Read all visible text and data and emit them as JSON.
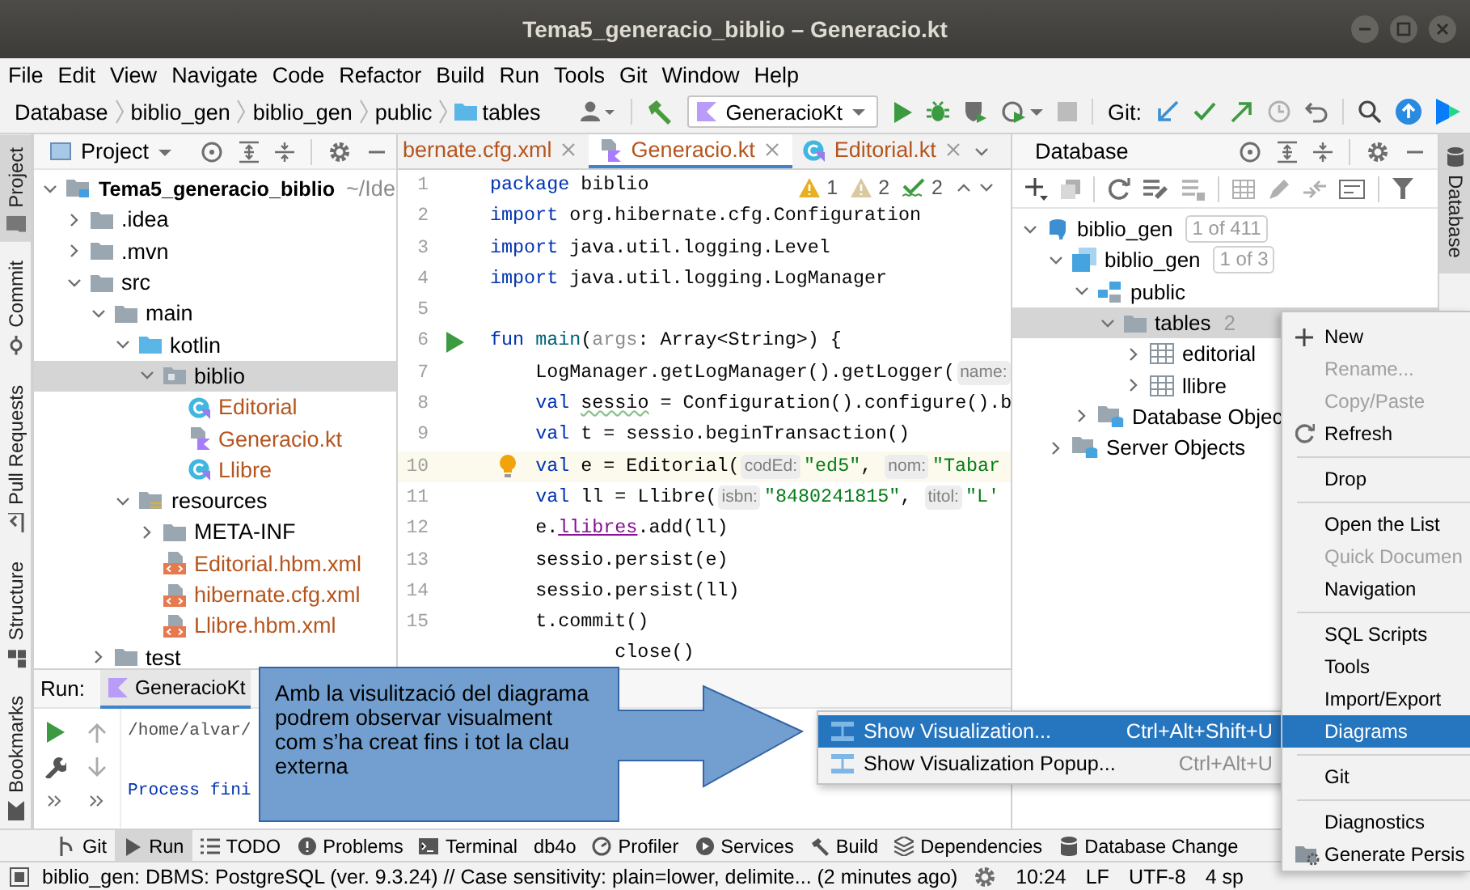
{
  "window": {
    "title": "Tema5_generacio_biblio – Generacio.kt"
  },
  "menu_bar": [
    "File",
    "Edit",
    "View",
    "Navigate",
    "Code",
    "Refactor",
    "Build",
    "Run",
    "Tools",
    "Git",
    "Window",
    "Help"
  ],
  "breadcrumb": [
    {
      "label": "Database"
    },
    {
      "label": "biblio_gen"
    },
    {
      "label": "biblio_gen"
    },
    {
      "label": "public"
    },
    {
      "label": "tables",
      "kind": "folder"
    }
  ],
  "toolbar": {
    "run_config": "GeneracioKt",
    "git_label": "Git:"
  },
  "left_tool_tabs": [
    {
      "label": "Project",
      "kind": "project",
      "selected": true
    },
    {
      "label": "Commit",
      "kind": "commit",
      "selected": false
    },
    {
      "label": "Pull Requests",
      "kind": "pull-requests",
      "selected": false
    },
    {
      "label": "Structure",
      "kind": "structure",
      "selected": false
    },
    {
      "label": "Bookmarks",
      "kind": "bookmarks",
      "selected": false
    }
  ],
  "project_panel": {
    "title": "Project",
    "tree": [
      {
        "label": "Tema5_generacio_biblio",
        "suffix": "~/Ide",
        "kind": "module",
        "expanded": true,
        "selected": false,
        "children": [
          {
            "label": ".idea",
            "kind": "folder",
            "expanded": false,
            "selected": false
          },
          {
            "label": ".mvn",
            "kind": "folder",
            "expanded": false,
            "selected": false
          },
          {
            "label": "src",
            "kind": "folder",
            "expanded": true,
            "selected": false,
            "children": [
              {
                "label": "main",
                "kind": "folder",
                "expanded": true,
                "selected": false,
                "children": [
                  {
                    "label": "kotlin",
                    "kind": "source-folder",
                    "expanded": true,
                    "selected": false,
                    "children": [
                      {
                        "label": "biblio",
                        "kind": "package",
                        "expanded": true,
                        "selected": true,
                        "children": [
                          {
                            "label": "Editorial",
                            "kind": "class",
                            "selected": false
                          },
                          {
                            "label": "Generacio.kt",
                            "kind": "kotlin-file",
                            "selected": false
                          },
                          {
                            "label": "Llibre",
                            "kind": "class",
                            "selected": false
                          }
                        ]
                      }
                    ]
                  },
                  {
                    "label": "resources",
                    "kind": "resources-folder",
                    "expanded": true,
                    "selected": false,
                    "children": [
                      {
                        "label": "META-INF",
                        "kind": "folder",
                        "expanded": false,
                        "selected": false
                      },
                      {
                        "label": "Editorial.hbm.xml",
                        "kind": "xml-file",
                        "selected": false
                      },
                      {
                        "label": "hibernate.cfg.xml",
                        "kind": "xml-file",
                        "selected": false
                      },
                      {
                        "label": "Llibre.hbm.xml",
                        "kind": "xml-file",
                        "selected": false
                      }
                    ]
                  }
                ]
              },
              {
                "label": "test",
                "kind": "folder",
                "expanded": false,
                "selected": false
              }
            ]
          }
        ]
      }
    ]
  },
  "editor": {
    "tabs": [
      {
        "label": "bernate.cfg.xml",
        "selected": false
      },
      {
        "label": "Generacio.kt",
        "kind": "kotlin-file",
        "selected": true
      },
      {
        "label": "Editorial.kt",
        "kind": "class",
        "selected": false
      }
    ],
    "inspections": [
      {
        "kind": "warning",
        "count": "1"
      },
      {
        "kind": "weak-warning",
        "count": "2"
      },
      {
        "kind": "typo",
        "count": "2"
      }
    ],
    "lines": [
      {
        "number": "1",
        "kind": "code",
        "current": false,
        "segments": [
          {
            "kind": "keyword",
            "text": "package"
          },
          {
            "kind": "plain",
            "text": " biblio"
          }
        ]
      },
      {
        "number": "2",
        "kind": "code",
        "current": false,
        "segments": [
          {
            "kind": "keyword",
            "text": "import"
          },
          {
            "kind": "plain",
            "text": " org.hibernate.cfg.Configuration"
          }
        ]
      },
      {
        "number": "3",
        "kind": "code",
        "current": false,
        "segments": [
          {
            "kind": "keyword",
            "text": "import"
          },
          {
            "kind": "plain",
            "text": " java.util.logging.Level"
          }
        ]
      },
      {
        "number": "4",
        "kind": "code",
        "current": false,
        "segments": [
          {
            "kind": "keyword",
            "text": "import"
          },
          {
            "kind": "plain",
            "text": " java.util.logging.LogManager"
          }
        ]
      },
      {
        "number": "5",
        "kind": "code",
        "current": false
      },
      {
        "number": "6",
        "kind": "run",
        "current": false,
        "segments": [
          {
            "kind": "keyword",
            "text": "fun "
          },
          {
            "kind": "function",
            "text": "main"
          },
          {
            "kind": "plain",
            "text": "("
          },
          {
            "kind": "unused",
            "text": "args"
          },
          {
            "kind": "plain",
            "text": ": Array<String>) {"
          }
        ]
      },
      {
        "number": "7",
        "kind": "code",
        "current": false,
        "segments": [
          {
            "kind": "plain",
            "text": "    LogManager.getLogManager().getLogger("
          },
          {
            "kind": "hint",
            "text": "name:"
          }
        ]
      },
      {
        "number": "8",
        "kind": "code",
        "current": false,
        "segments": [
          {
            "kind": "keyword",
            "text": "    val "
          },
          {
            "kind": "typo",
            "text": "sessio"
          },
          {
            "kind": "plain",
            "text": " = Configuration().configure().b"
          }
        ]
      },
      {
        "number": "9",
        "kind": "code",
        "current": false,
        "segments": [
          {
            "kind": "keyword",
            "text": "    val"
          },
          {
            "kind": "plain",
            "text": " t = sessio.beginTransaction()"
          }
        ]
      },
      {
        "number": "10",
        "kind": "bulb",
        "current": true,
        "segments": [
          {
            "kind": "keyword",
            "text": "    val"
          },
          {
            "kind": "plain",
            "text": " e = Editorial("
          },
          {
            "kind": "hint",
            "text": "codEd:"
          },
          {
            "kind": "string",
            "text": "\"ed5\""
          },
          {
            "kind": "plain",
            "text": ", "
          },
          {
            "kind": "hint",
            "text": "nom:"
          },
          {
            "kind": "string",
            "text": "\"Tabar"
          }
        ]
      },
      {
        "number": "11",
        "kind": "code",
        "current": false,
        "segments": [
          {
            "kind": "keyword",
            "text": "    val"
          },
          {
            "kind": "plain",
            "text": " ll = Llibre("
          },
          {
            "kind": "hint",
            "text": "isbn:"
          },
          {
            "kind": "string",
            "text": "\"8480241815\""
          },
          {
            "kind": "plain",
            "text": ", "
          },
          {
            "kind": "hint",
            "text": "titol:"
          },
          {
            "kind": "string",
            "text": "\"L'"
          }
        ]
      },
      {
        "number": "12",
        "kind": "code",
        "current": false,
        "segments": [
          {
            "kind": "plain",
            "text": "    e."
          },
          {
            "kind": "property",
            "text": "llibres"
          },
          {
            "kind": "plain",
            "text": ".add(ll)"
          }
        ]
      },
      {
        "number": "13",
        "kind": "code",
        "current": false,
        "segments": [
          {
            "kind": "plain",
            "text": "    sessio.persist(e)"
          }
        ]
      },
      {
        "number": "14",
        "kind": "code",
        "current": false,
        "segments": [
          {
            "kind": "plain",
            "text": "    sessio.persist(ll)"
          }
        ]
      },
      {
        "number": "15",
        "kind": "code",
        "current": false,
        "segments": [
          {
            "kind": "plain",
            "text": "    t.commit()"
          }
        ]
      },
      {
        "kind": "code",
        "current": false,
        "segments": [
          {
            "kind": "plain",
            "text": "           close()"
          }
        ]
      }
    ]
  },
  "database_panel": {
    "title": "Database",
    "tree": [
      {
        "label": "biblio_gen",
        "badge": "1 of 411",
        "kind": "datasource",
        "expanded": true,
        "selected": false,
        "children": [
          {
            "label": "biblio_gen",
            "badge": "1 of 3",
            "kind": "database",
            "expanded": true,
            "selected": false,
            "children": [
              {
                "label": "public",
                "kind": "schema",
                "expanded": true,
                "selected": false,
                "children": [
                  {
                    "label": "tables",
                    "count": "2",
                    "kind": "folder",
                    "expanded": true,
                    "selected": true,
                    "children": [
                      {
                        "label": "editorial",
                        "kind": "table",
                        "expanded": false,
                        "selected": false
                      },
                      {
                        "label": "llibre",
                        "kind": "table",
                        "expanded": false,
                        "selected": false
                      }
                    ]
                  }
                ]
              },
              {
                "label": "Database Objec",
                "kind": "objects-folder",
                "expanded": false,
                "selected": false
              }
            ]
          },
          {
            "label": "Server Objects",
            "kind": "objects-folder",
            "expanded": false,
            "selected": false
          }
        ]
      }
    ]
  },
  "right_tool_tabs": [
    {
      "label": "Database",
      "selected": true
    }
  ],
  "run_panel": {
    "label": "Run:",
    "tab": "GeneracioKt",
    "output": [
      {
        "kind": "command",
        "text": "/home/alvar/"
      },
      {
        "kind": "system",
        "text": "Process fini"
      }
    ]
  },
  "tool_window_bar": [
    {
      "label": "Git",
      "kind": "git",
      "selected": false
    },
    {
      "label": "Run",
      "kind": "run",
      "selected": true
    },
    {
      "label": "TODO",
      "kind": "todo",
      "selected": false
    },
    {
      "label": "Problems",
      "kind": "problems",
      "selected": false
    },
    {
      "label": "Terminal",
      "kind": "terminal",
      "selected": false
    },
    {
      "label": "db4o",
      "kind": "plugin",
      "selected": false
    },
    {
      "label": "Profiler",
      "kind": "profiler",
      "selected": false
    },
    {
      "label": "Services",
      "kind": "services",
      "selected": false
    },
    {
      "label": "Build",
      "kind": "build",
      "selected": false
    },
    {
      "label": "Dependencies",
      "kind": "dependencies",
      "selected": false
    },
    {
      "label": "Database Change",
      "kind": "database",
      "selected": false
    }
  ],
  "status_bar": {
    "message": "biblio_gen: DBMS: PostgreSQL (ver. 9.3.24) // Case sensitivity: plain=lower, delimite... (2 minutes ago)",
    "items": [
      "10:24",
      "LF",
      "UTF-8",
      "4 sp"
    ]
  },
  "context_menu": {
    "groups": [
      [
        {
          "label": "New",
          "kind": "new",
          "disabled": false,
          "selected": false
        },
        {
          "label": "Rename...",
          "kind": "plain",
          "disabled": true,
          "selected": false
        },
        {
          "label": "Copy/Paste",
          "kind": "plain",
          "disabled": true,
          "selected": false
        },
        {
          "label": "Refresh",
          "kind": "refresh",
          "disabled": false,
          "selected": false
        }
      ],
      [
        {
          "label": "Drop",
          "kind": "plain",
          "disabled": false,
          "selected": false
        }
      ],
      [
        {
          "label": "Open the List",
          "kind": "plain",
          "disabled": false,
          "selected": false
        },
        {
          "label": "Quick Documen",
          "kind": "plain",
          "disabled": true,
          "selected": false
        },
        {
          "label": "Navigation",
          "kind": "plain",
          "disabled": false,
          "selected": false
        }
      ],
      [
        {
          "label": "SQL Scripts",
          "kind": "plain",
          "disabled": false,
          "selected": false
        },
        {
          "label": "Tools",
          "kind": "plain",
          "disabled": false,
          "selected": false
        },
        {
          "label": "Import/Export",
          "kind": "plain",
          "disabled": false,
          "selected": false
        },
        {
          "label": "Diagrams",
          "kind": "plain",
          "disabled": false,
          "selected": true
        }
      ],
      [
        {
          "label": "Git",
          "kind": "plain",
          "disabled": false,
          "selected": false
        }
      ],
      [
        {
          "label": "Diagnostics",
          "kind": "plain",
          "disabled": false,
          "selected": false
        },
        {
          "label": "Generate Persis",
          "kind": "generate",
          "disabled": false,
          "selected": false
        }
      ]
    ]
  },
  "submenu": {
    "items": [
      {
        "label": "Show Visualization...",
        "shortcut": "Ctrl+Alt+Shift+U",
        "selected": true
      },
      {
        "label": "Show Visualization Popup...",
        "shortcut": "Ctrl+Alt+U",
        "selected": false
      }
    ]
  },
  "callout": {
    "text": "Amb la visulització del diagrama podrem observar visualment com s’ha creat fins i tot la clau externa"
  }
}
